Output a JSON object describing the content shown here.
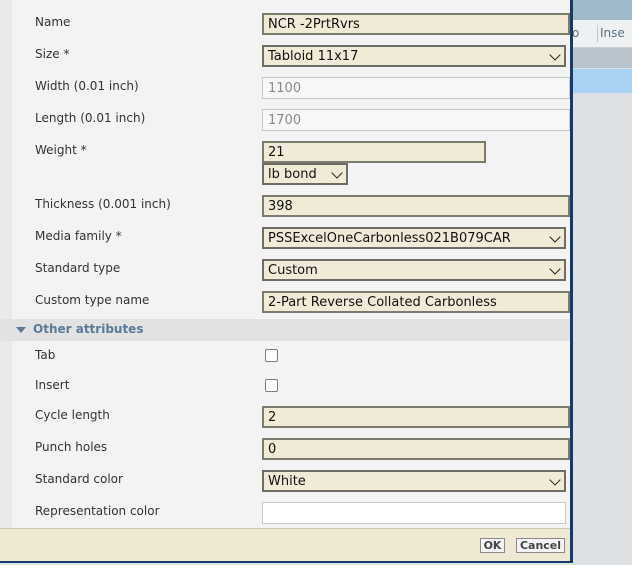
{
  "background_window": {
    "columns": [
      "o",
      "Inse"
    ]
  },
  "form": {
    "name": {
      "label": "Name",
      "value": "NCR -2PrtRvrs"
    },
    "size": {
      "label": "Size *",
      "value": "Tabloid 11x17"
    },
    "width": {
      "label": "Width (0.01 inch)",
      "value": "1100"
    },
    "length": {
      "label": "Length (0.01 inch)",
      "value": "1700"
    },
    "weight": {
      "label": "Weight *",
      "value": "21",
      "unit": "lb bond"
    },
    "thickness": {
      "label": "Thickness (0.001 inch)",
      "value": "398"
    },
    "media_family": {
      "label": "Media family *",
      "value": "PSSExcelOneCarbonless021B079CAR"
    },
    "standard_type": {
      "label": "Standard type",
      "value": "Custom"
    },
    "custom_type_name": {
      "label": "Custom type name",
      "value": "2-Part Reverse Collated Carbonless"
    }
  },
  "other_attributes": {
    "title": "Other attributes",
    "tab": {
      "label": "Tab",
      "checked": false
    },
    "insert": {
      "label": "Insert",
      "checked": false
    },
    "cycle_length": {
      "label": "Cycle length",
      "value": "2"
    },
    "punch_holes": {
      "label": "Punch holes",
      "value": "0"
    },
    "standard_color": {
      "label": "Standard color",
      "value": "White"
    },
    "representation_color": {
      "label": "Representation color",
      "value": ""
    }
  },
  "footer": {
    "ok_label": "OK",
    "cancel_label": "Cancel"
  },
  "colors": {
    "field_bg": "#f0ead6",
    "footer_bg": "#efe8d3",
    "dialog_border": "#163a6b",
    "section_text": "#5a7a98"
  }
}
